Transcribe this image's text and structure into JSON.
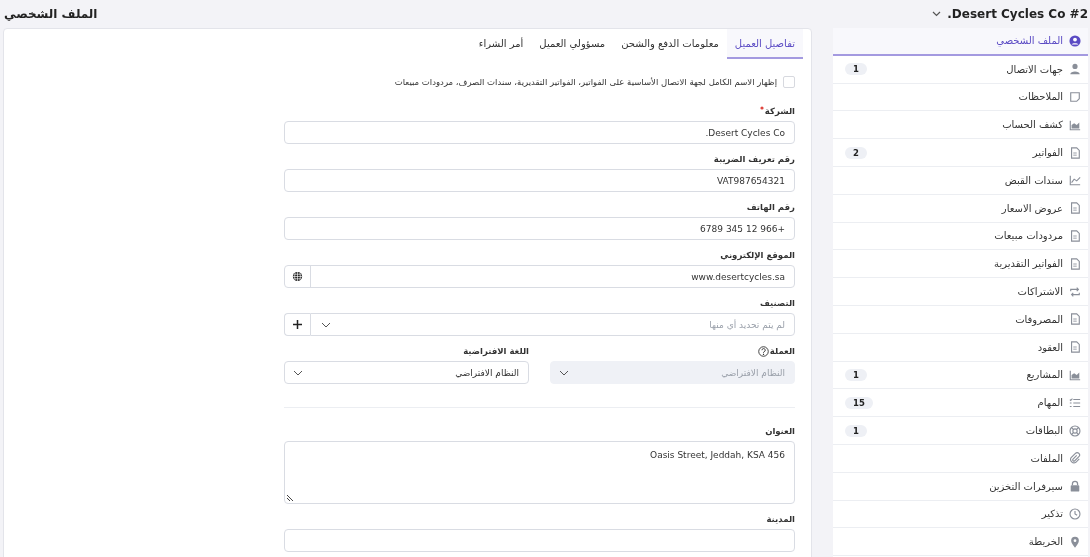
{
  "header": {
    "title": "الملف الشخصي",
    "client": "#2 Desert Cycles Co."
  },
  "sidebar": {
    "items": [
      {
        "label": "الملف الشخصي",
        "selected": true
      },
      {
        "label": "جهات الاتصال",
        "selected": false,
        "count": "1"
      },
      {
        "label": "الملاحظات",
        "selected": false
      },
      {
        "label": "كشف الحساب",
        "selected": false
      },
      {
        "label": "الفواتير",
        "selected": false,
        "count": "2"
      },
      {
        "label": "سندات القبض",
        "selected": false
      },
      {
        "label": "عروض الاسعار",
        "selected": false
      },
      {
        "label": "مردودات مبيعات",
        "selected": false
      },
      {
        "label": "الفواتير التقديرية",
        "selected": false
      },
      {
        "label": "الاشتراكات",
        "selected": false
      },
      {
        "label": "المصروفات",
        "selected": false
      },
      {
        "label": "العقود",
        "selected": false
      },
      {
        "label": "المشاريع",
        "selected": false,
        "count": "1"
      },
      {
        "label": "المهام",
        "selected": false,
        "count": "15"
      },
      {
        "label": "البطاقات",
        "selected": false,
        "count": "1"
      },
      {
        "label": "الملفات",
        "selected": false
      },
      {
        "label": "سيرفرات التخزين",
        "selected": false
      },
      {
        "label": "تذكير",
        "selected": false
      },
      {
        "label": "الخريطة",
        "selected": false
      }
    ]
  },
  "tabs": [
    {
      "label": "تفاصيل العميل",
      "selected": true
    },
    {
      "label": "معلومات الدفع والشحن",
      "selected": false
    },
    {
      "label": "مسؤولي العميل",
      "selected": false
    },
    {
      "label": "أمر الشراء",
      "selected": false
    }
  ],
  "form": {
    "show_contact_name": {
      "label": "إظهار الاسم الكامل لجهة الاتصال الأساسية على الفواتير، الفواتير التقديرية، سندات الصرف، مردودات مبيعات",
      "checked": false
    },
    "fields": [
      {
        "kind": "text",
        "label": "الشركة",
        "required": true,
        "value": "Desert Cycles Co."
      },
      {
        "kind": "text",
        "label": "رقم تعريف الضريبة",
        "required": false,
        "value": "VAT987654321"
      },
      {
        "kind": "text",
        "label": "رقم الهاتف",
        "required": false,
        "value": "+966 12 345 6789"
      },
      {
        "kind": "url",
        "label": "الموقع الإلكتروني",
        "required": false,
        "value": "www.desertcycles.sa"
      },
      {
        "kind": "multiselect",
        "label": "التصنيف",
        "required": false,
        "placeholder": "لم يتم تحديد أي منها"
      }
    ],
    "currency": {
      "label": "العملة",
      "value": "النظام الافتراضي",
      "disabled": true
    },
    "language": {
      "label": "اللغة الافتراضية",
      "value": "النظام الافتراضي",
      "disabled": false
    },
    "address": {
      "label": "العنوان",
      "value": "Oasis Street, Jeddah, KSA 456"
    },
    "city": {
      "label": "المدينة"
    }
  }
}
